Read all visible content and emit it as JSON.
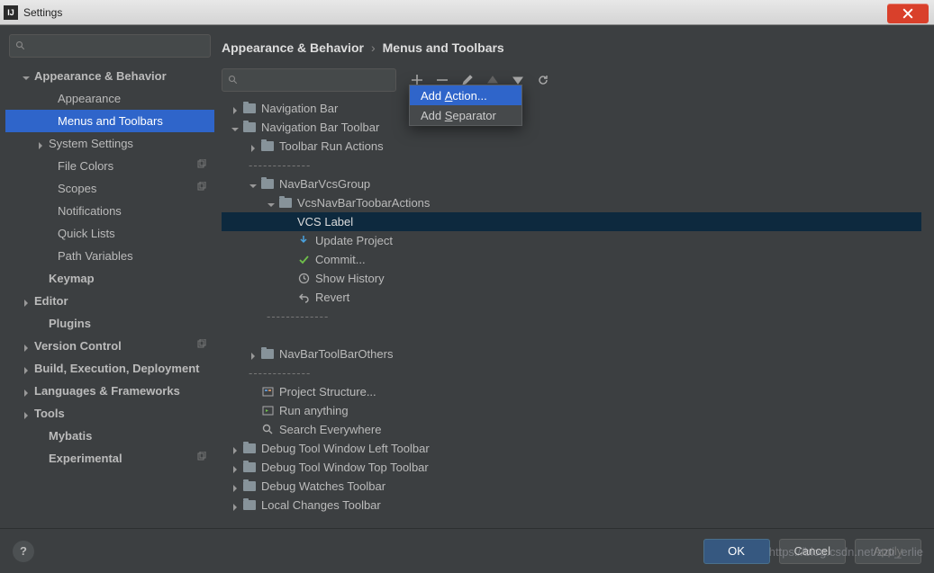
{
  "window": {
    "title": "Settings",
    "watermark": "https://blog.csdn.net/zzti_erlie"
  },
  "search_placeholder": "",
  "sidebar": {
    "items": [
      {
        "label": "Appearance & Behavior",
        "bold": true,
        "arrow": "down",
        "indent": 1
      },
      {
        "label": "Appearance",
        "indent": 3
      },
      {
        "label": "Menus and Toolbars",
        "indent": 3,
        "selected": true
      },
      {
        "label": "System Settings",
        "arrow": "right",
        "indent": 2
      },
      {
        "label": "File Colors",
        "indent": 3,
        "badge": true
      },
      {
        "label": "Scopes",
        "indent": 3,
        "badge": true
      },
      {
        "label": "Notifications",
        "indent": 3
      },
      {
        "label": "Quick Lists",
        "indent": 3
      },
      {
        "label": "Path Variables",
        "indent": 3
      },
      {
        "label": "Keymap",
        "bold": true,
        "indent": 2
      },
      {
        "label": "Editor",
        "bold": true,
        "arrow": "right",
        "indent": 1
      },
      {
        "label": "Plugins",
        "bold": true,
        "indent": 2
      },
      {
        "label": "Version Control",
        "bold": true,
        "arrow": "right",
        "indent": 1,
        "badge": true
      },
      {
        "label": "Build, Execution, Deployment",
        "bold": true,
        "arrow": "right",
        "indent": 1
      },
      {
        "label": "Languages & Frameworks",
        "bold": true,
        "arrow": "right",
        "indent": 1
      },
      {
        "label": "Tools",
        "bold": true,
        "arrow": "right",
        "indent": 1
      },
      {
        "label": "Mybatis",
        "bold": true,
        "indent": 2
      },
      {
        "label": "Experimental",
        "bold": true,
        "indent": 2,
        "badge": true
      }
    ]
  },
  "breadcrumb": {
    "a": "Appearance & Behavior",
    "b": "Menus and Toolbars"
  },
  "toolbar": {
    "add": "add",
    "remove": "remove",
    "edit": "edit",
    "up": "up",
    "down": "down",
    "reset": "reset"
  },
  "popup": {
    "add_action": "Add Action...",
    "add_separator": "Add Separator",
    "u1": "A",
    "u2": "S"
  },
  "main": [
    {
      "indent": 0,
      "arrow": "right",
      "icon": "folder",
      "label": "Navigation Bar"
    },
    {
      "indent": 0,
      "arrow": "down",
      "icon": "folder",
      "label": "Navigation Bar Toolbar"
    },
    {
      "indent": 1,
      "arrow": "right",
      "icon": "folder",
      "label": "Toolbar Run Actions"
    },
    {
      "indent": 1,
      "sep": true
    },
    {
      "indent": 1,
      "arrow": "down",
      "icon": "folder",
      "label": "NavBarVcsGroup"
    },
    {
      "indent": 2,
      "arrow": "down",
      "icon": "folder",
      "label": "VcsNavBarToobarActions"
    },
    {
      "indent": 3,
      "label": "VCS Label",
      "selected": true
    },
    {
      "indent": 3,
      "icon": "update",
      "label": "Update Project"
    },
    {
      "indent": 3,
      "icon": "commit",
      "label": "Commit..."
    },
    {
      "indent": 3,
      "icon": "history",
      "label": "Show History"
    },
    {
      "indent": 3,
      "icon": "revert",
      "label": "Revert"
    },
    {
      "indent": 2,
      "sep": true
    },
    {
      "indent": 2,
      "sep_blank": true
    },
    {
      "indent": 1,
      "arrow": "right",
      "icon": "folder",
      "label": "NavBarToolBarOthers"
    },
    {
      "indent": 1,
      "sep": true
    },
    {
      "indent": 1,
      "icon": "struct",
      "label": "Project Structure..."
    },
    {
      "indent": 1,
      "icon": "run",
      "label": "Run anything"
    },
    {
      "indent": 1,
      "icon": "search",
      "label": "Search Everywhere"
    },
    {
      "indent": 0,
      "arrow": "right",
      "icon": "folder",
      "label": "Debug Tool Window Left Toolbar"
    },
    {
      "indent": 0,
      "arrow": "right",
      "icon": "folder",
      "label": "Debug Tool Window Top Toolbar"
    },
    {
      "indent": 0,
      "arrow": "right",
      "icon": "folder",
      "label": "Debug Watches Toolbar"
    },
    {
      "indent": 0,
      "arrow": "right",
      "icon": "folder",
      "label": "Local Changes Toolbar"
    }
  ],
  "footer": {
    "ok": "OK",
    "cancel": "Cancel",
    "apply": "Apply",
    "help": "?"
  }
}
